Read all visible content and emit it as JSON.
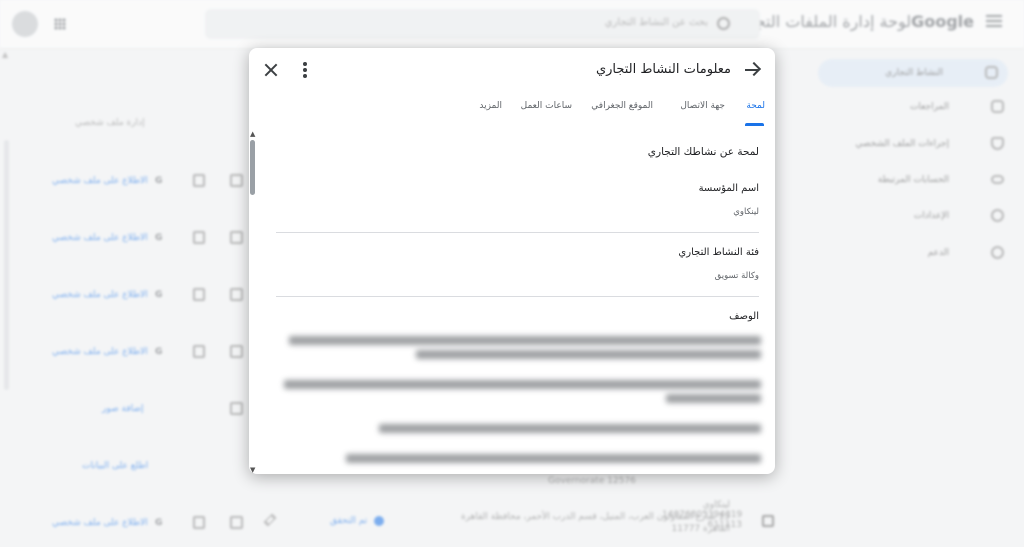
{
  "topbar": {
    "logo_google": "Google",
    "logo_text": "لوحة إدارة الملفات التجارية",
    "search_placeholder": "بحث عن النشاط التجاري",
    "hamburger_icon": "menu-icon",
    "apps_icon": "apps-grid-icon"
  },
  "sidebar": {
    "items": [
      {
        "label": "النشاط التجاري",
        "icon": "storefront-icon"
      },
      {
        "label": "المراجعات",
        "icon": "reviews-icon"
      },
      {
        "label": "إجراءات الملف الشخصي",
        "icon": "shield-icon"
      },
      {
        "label": "الحسابات المرتبطة",
        "icon": "link-icon"
      },
      {
        "label": "الإعدادات",
        "icon": "settings-icon"
      },
      {
        "label": "الدعم",
        "icon": "help-icon"
      }
    ]
  },
  "background": {
    "list_header": "إدارة ملف شخصي",
    "row_link": "الاطلاع على ملف شخصي",
    "g_letter": "G",
    "add_images": "إضافة صور",
    "view_data": "اطلع على البيانات",
    "listing_name": "لينكاوي",
    "listing_address": "15 شارع المقاولون العرب، المنيل، قسم الدرب الأحمر، محافظة القاهرة",
    "listing_zip": "القاهرة 11777",
    "governorate": "Governorate 12576",
    "phone_line1": "14076805394319",
    "phone_line2": "611113",
    "status_label": "تم التحقق",
    "colors": {
      "accent": "#1a73e8"
    }
  },
  "modal": {
    "title": "معلومات النشاط التجاري",
    "icons": {
      "back": "arrow-icon",
      "more": "more-vert-icon",
      "close": "close-icon"
    },
    "tabs": [
      {
        "label": "لمحة",
        "active": true
      },
      {
        "label": "جهة الاتصال",
        "active": false
      },
      {
        "label": "الموقع الجغرافي",
        "active": false
      },
      {
        "label": "ساعات العمل",
        "active": false
      },
      {
        "label": "المزيد",
        "active": false
      }
    ],
    "section_title": "لمحة عن نشاطك التجاري",
    "fields": [
      {
        "label": "اسم المؤسسة",
        "value": "لينكاوي"
      },
      {
        "label": "فئة النشاط التجاري",
        "value": "وكالة تسويق"
      },
      {
        "label": "الوصف",
        "value": ""
      }
    ]
  }
}
